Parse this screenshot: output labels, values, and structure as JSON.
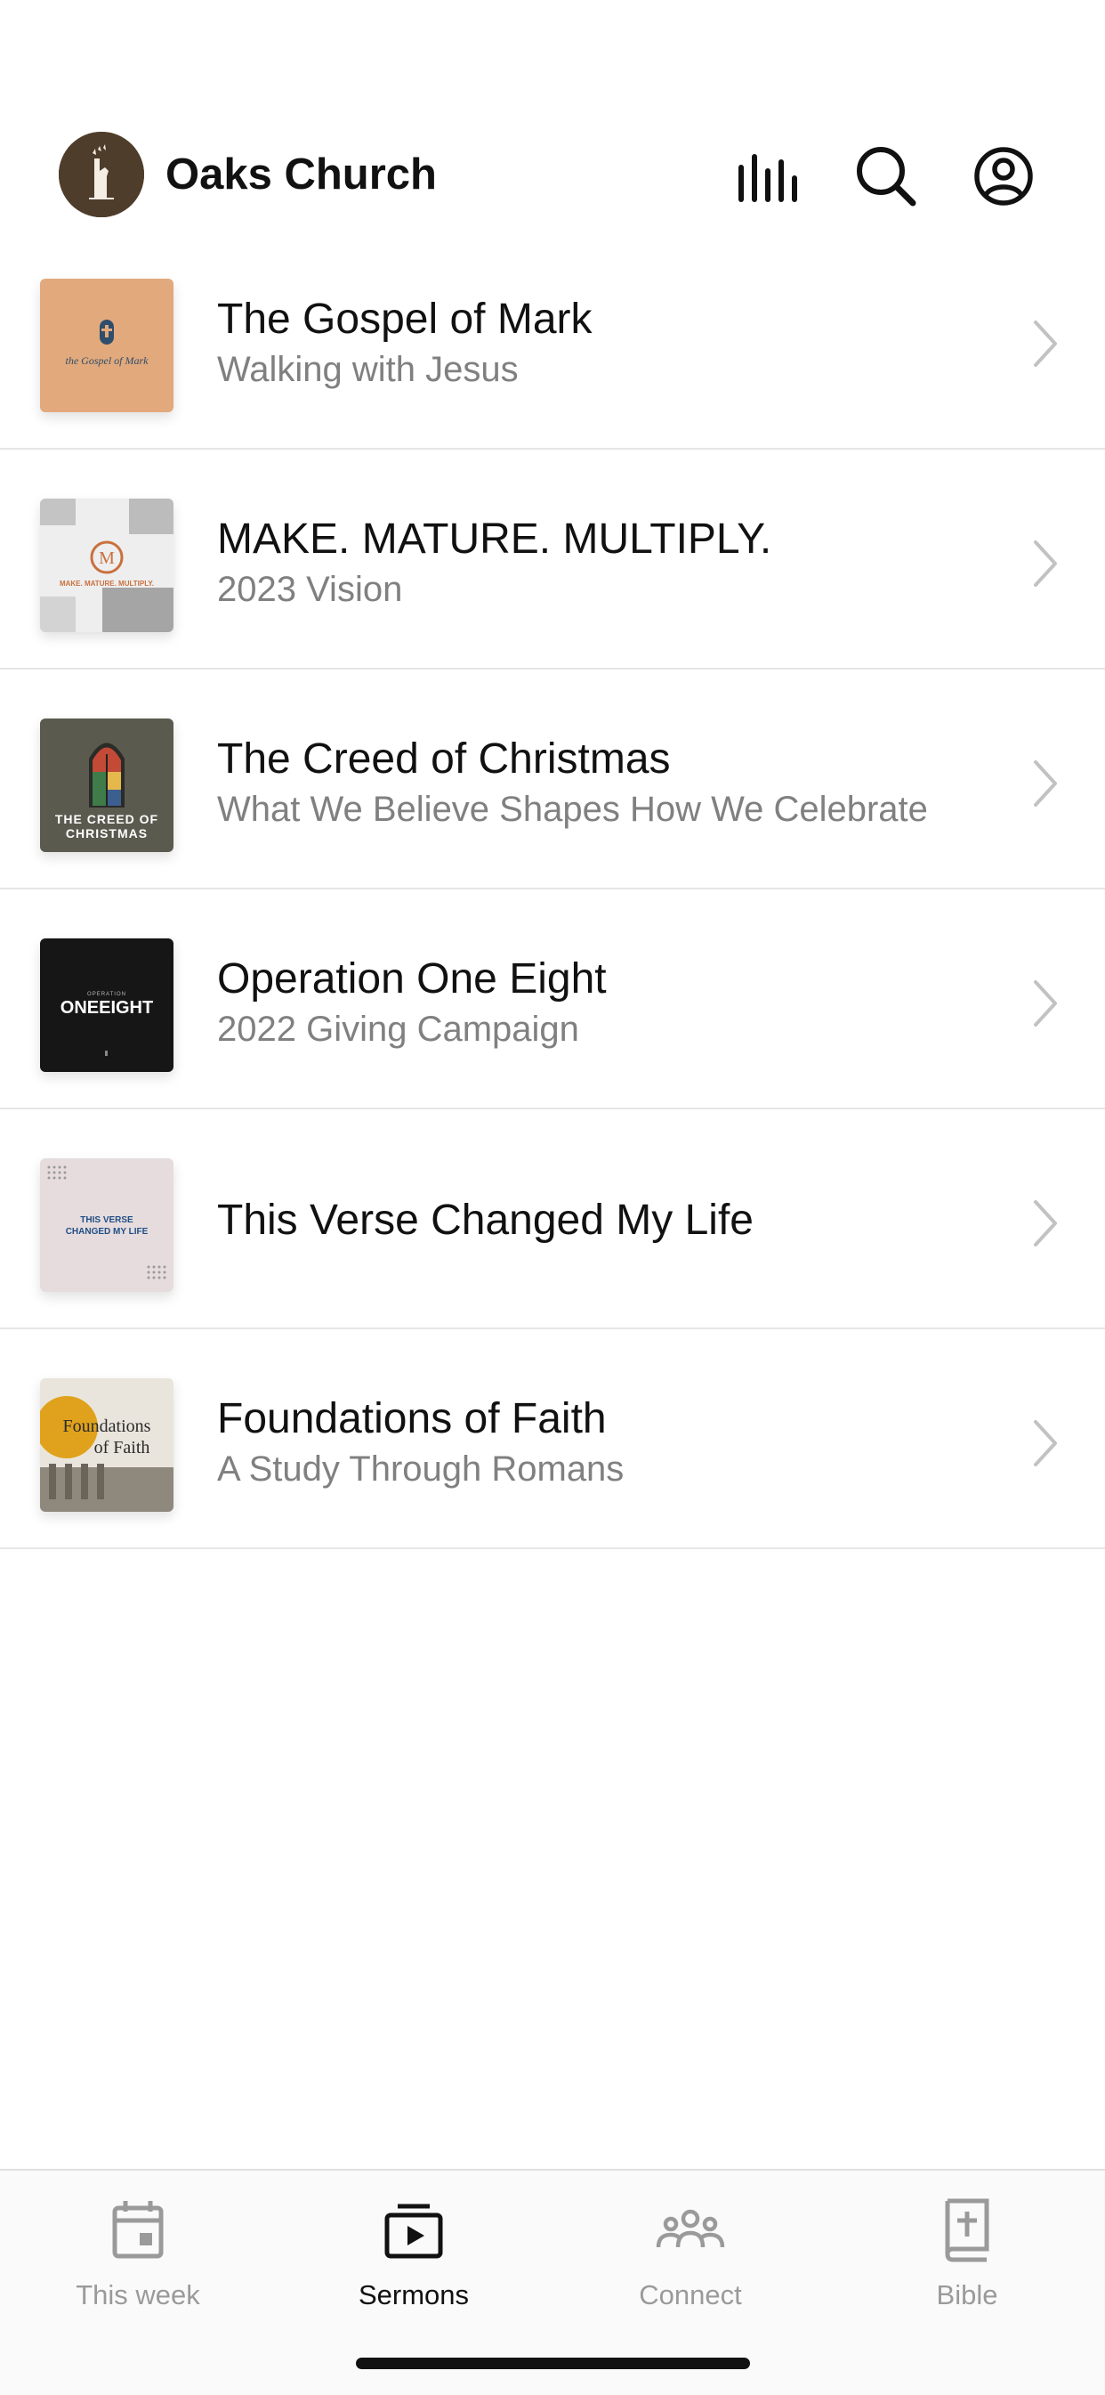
{
  "header": {
    "title": "Oaks Church",
    "icons": [
      "audio-bars-icon",
      "search-icon",
      "account-icon"
    ]
  },
  "series": [
    {
      "title": "The Gospel of Mark",
      "subtitle": "Walking with Jesus",
      "art_text": "the Gospel of Mark"
    },
    {
      "title": "MAKE. MATURE. MULTIPLY.",
      "subtitle": "2023 Vision",
      "art_text": "MAKE. MATURE. MULTIPLY."
    },
    {
      "title": "The Creed of Christmas",
      "subtitle": "What We Believe Shapes How We Celebrate",
      "art_text": "THE CREED OF CHRISTMAS"
    },
    {
      "title": "Operation One Eight",
      "subtitle": "2022 Giving Campaign",
      "art_text": "ONEEIGHT"
    },
    {
      "title": "This Verse Changed My Life",
      "subtitle": "",
      "art_text": "THIS VERSE CHANGED MY LIFE"
    },
    {
      "title": "Foundations of Faith",
      "subtitle": "A Study Through Romans",
      "art_text": "Foundations of Faith"
    }
  ],
  "tabs": [
    {
      "label": "This week",
      "icon": "calendar-icon",
      "active": false
    },
    {
      "label": "Sermons",
      "icon": "play-stack-icon",
      "active": true
    },
    {
      "label": "Connect",
      "icon": "people-icon",
      "active": false
    },
    {
      "label": "Bible",
      "icon": "bible-icon",
      "active": false
    }
  ],
  "colors": {
    "active_tab": "#111111",
    "inactive_tab": "#9a9a9a",
    "subtitle": "#808080",
    "logo_bg": "#4e3d2b"
  }
}
